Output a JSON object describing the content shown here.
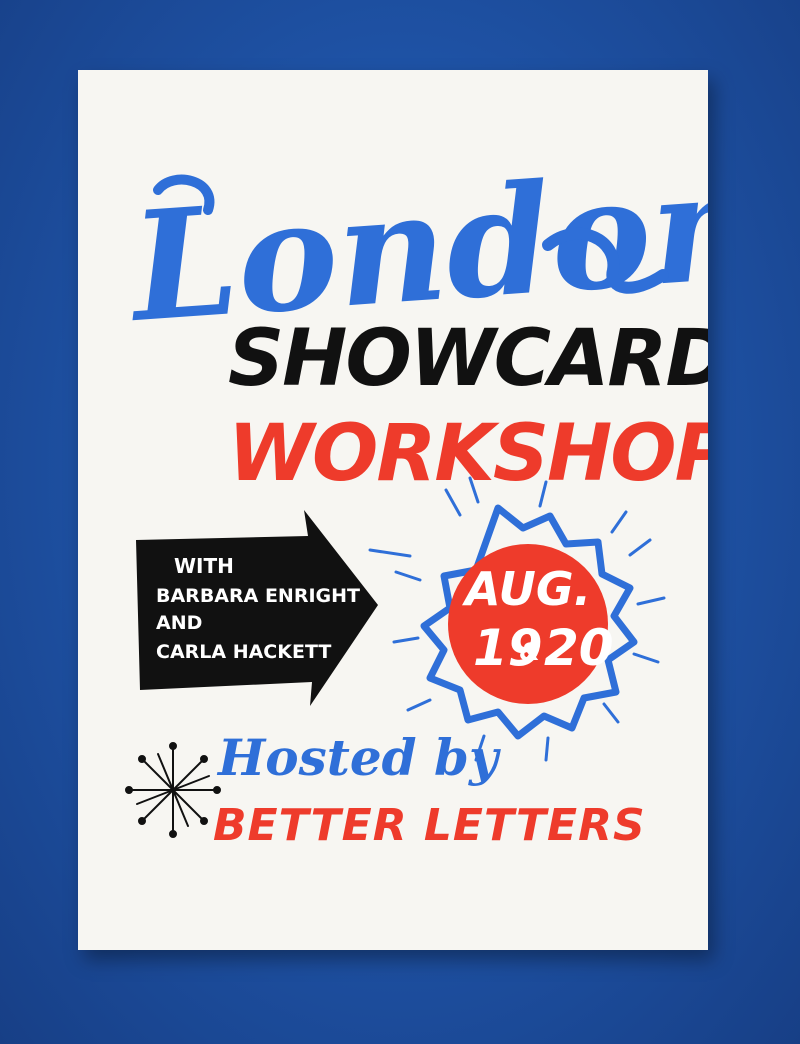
{
  "poster": {
    "title_script": "London",
    "title_line1": "SHOWCARD",
    "title_line2": "WORKSHOP",
    "hosts_line1": "WITH",
    "hosts_line2": "BARBARA ENRIGHT",
    "hosts_line3": "AND",
    "hosts_line4": "CARLA HACKETT",
    "date_line1": "AUG.",
    "date_line2_a": "19",
    "date_line2_amp": "&",
    "date_line2_b": "20",
    "hosted_by": "Hosted by",
    "host_name": "BETTER LETTERS"
  },
  "colors": {
    "background_blue": "#1d4fa0",
    "paper": "#f7f6f2",
    "ink_blue": "#2f6fd8",
    "ink_red": "#ee3b2b",
    "ink_black": "#111111",
    "ink_white": "#ffffff"
  },
  "icons": {
    "burst": "starburst-icon",
    "arrow": "arrow-right-banner",
    "sparkle": "sparkle-burst-icon"
  }
}
